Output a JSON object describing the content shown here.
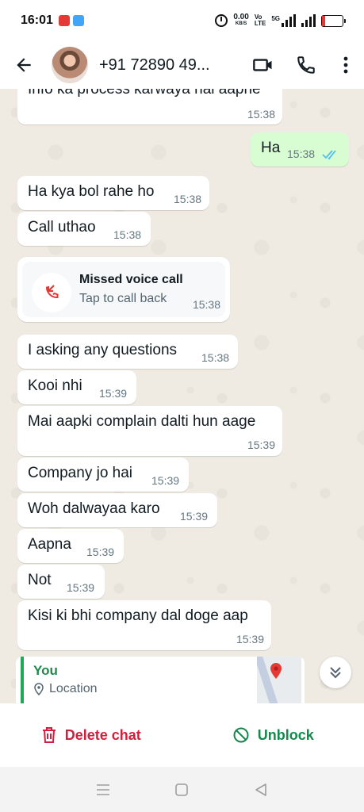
{
  "status_bar": {
    "time": "16:01",
    "net_speed": "0.00",
    "net_unit": "KB/S",
    "volte_top": "Vo",
    "volte_bottom": "LTE",
    "gen1": "5G",
    "battery": "17",
    "battery_level": 0.17
  },
  "header": {
    "contact_name": "+91 72890 49...",
    "icons": [
      "back-arrow-icon",
      "video-call-icon",
      "voice-call-icon",
      "more-options-icon"
    ]
  },
  "messages": [
    {
      "dir": "in",
      "text": "Info ka process karwaya hai aapne",
      "time": "15:38"
    },
    {
      "dir": "out",
      "text": "Ha",
      "time": "15:38",
      "status": "read"
    },
    {
      "dir": "in",
      "text": "Ha kya bol rahe ho",
      "time": "15:38"
    },
    {
      "dir": "in",
      "text": "Call uthao",
      "time": "15:38"
    },
    {
      "dir": "in",
      "type": "missed_call",
      "title": "Missed voice call",
      "subtitle": "Tap to call back",
      "time": "15:38"
    },
    {
      "dir": "in",
      "text": "I asking any questions",
      "time": "15:38"
    },
    {
      "dir": "in",
      "text": "Kooi nhi",
      "time": "15:39"
    },
    {
      "dir": "in",
      "text": "Mai aapki complain dalti hun aage",
      "time": "15:39"
    },
    {
      "dir": "in",
      "text": "Company jo hai",
      "time": "15:39"
    },
    {
      "dir": "in",
      "text": "Woh dalwayaa karo",
      "time": "15:39"
    },
    {
      "dir": "in",
      "text": "Aapna",
      "time": "15:39"
    },
    {
      "dir": "in",
      "text": "Not",
      "time": "15:39"
    },
    {
      "dir": "in",
      "text": "Kisi ki bhi company dal doge aap",
      "time": "15:39"
    }
  ],
  "location_reply": {
    "sender": "You",
    "label": "Location"
  },
  "actions": {
    "delete": "Delete chat",
    "unblock": "Unblock"
  },
  "colors": {
    "danger": "#d21f3c",
    "accent_green": "#14894d",
    "outgoing_bubble": "#d9fdd3",
    "read_ticks": "#53bdeb",
    "chat_bg": "#efeae2"
  },
  "nav_bar": {
    "icons": [
      "menu-icon",
      "home-icon",
      "back-icon"
    ]
  }
}
